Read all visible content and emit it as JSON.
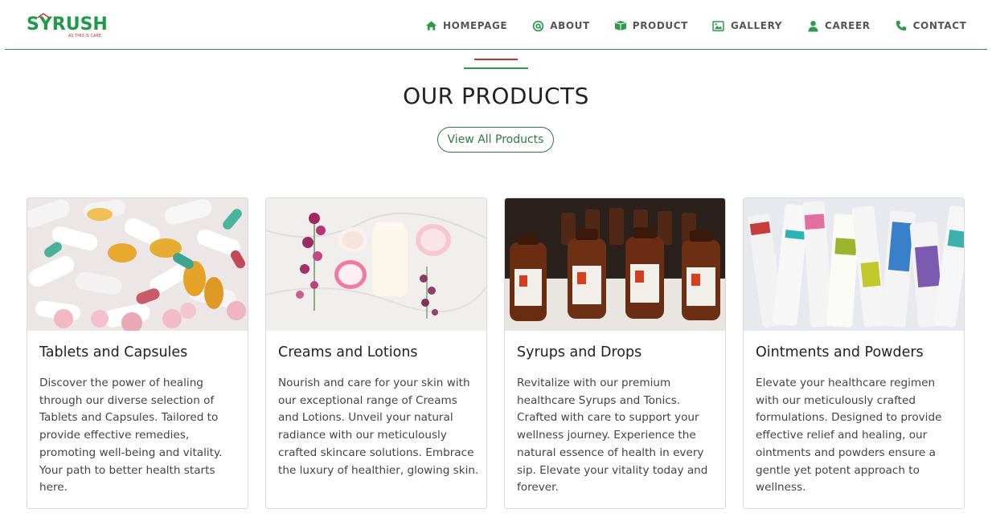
{
  "brand": {
    "name": "SYRUSH",
    "tagline": "AS THIS IS CARE"
  },
  "nav": [
    {
      "label": "HOMEPAGE",
      "icon": "home-icon"
    },
    {
      "label": "ABOUT",
      "icon": "at-icon"
    },
    {
      "label": "PRODUCT",
      "icon": "box-icon"
    },
    {
      "label": "GALLERY",
      "icon": "image-icon"
    },
    {
      "label": "CAREER",
      "icon": "user-icon"
    },
    {
      "label": "CONTACT",
      "icon": "phone-icon"
    }
  ],
  "section": {
    "title": "OUR PRODUCTS",
    "view_all_label": "View All Products"
  },
  "products": [
    {
      "title": "Tablets and Capsules",
      "description": "Discover the power of healing through our diverse selection of Tablets and Capsules. Tailored to provide effective remedies, promoting well-being and vitality. Your path to better health starts here."
    },
    {
      "title": "Creams and Lotions",
      "description": "Nourish and care for your skin with our exceptional range of Creams and Lotions. Unveil your natural radiance with our meticulously crafted skincare solutions. Embrace the luxury of healthier, glowing skin."
    },
    {
      "title": "Syrups and Drops",
      "description": "Revitalize with our premium healthcare Syrups and Tonics. Crafted with care to support your wellness journey. Experience the natural essence of health in every sip. Elevate your vitality today and forever."
    },
    {
      "title": "Ointments and Powders",
      "description": "Elevate your healthcare regimen with our meticulously crafted formulations. Designed to provide effective relief and healing, our ointments and powders ensure a gentle yet potent approach to wellness."
    }
  ],
  "colors": {
    "accent_green": "#2d7a45",
    "accent_red": "#d12b2b",
    "icon_green": "#2e9a4a"
  }
}
